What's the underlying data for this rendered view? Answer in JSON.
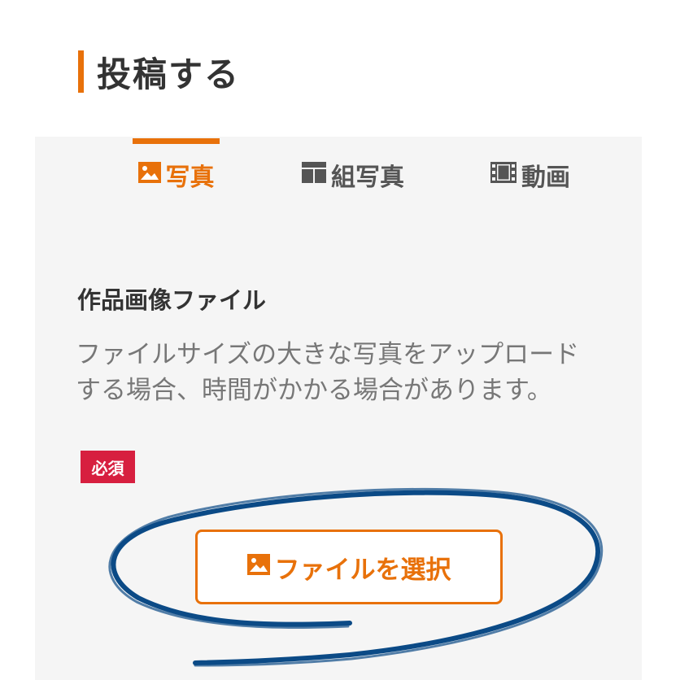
{
  "page": {
    "title": "投稿する"
  },
  "tabs": [
    {
      "label": "写真",
      "icon": "image-icon",
      "active": true
    },
    {
      "label": "組写真",
      "icon": "grid-icon",
      "active": false
    },
    {
      "label": "動画",
      "icon": "film-icon",
      "active": false
    }
  ],
  "form": {
    "field_label": "作品画像ファイル",
    "description_line1": "ファイルサイズの大きな写真をアップロード",
    "description_line2": "する場合、時間がかかる場合があります。",
    "required_badge": "必須",
    "file_button_label": "ファイルを選択"
  },
  "colors": {
    "accent": "#e8710a",
    "required": "#d71f3f",
    "panel_bg": "#f5f5f5",
    "annotation": "#0b4a86"
  }
}
